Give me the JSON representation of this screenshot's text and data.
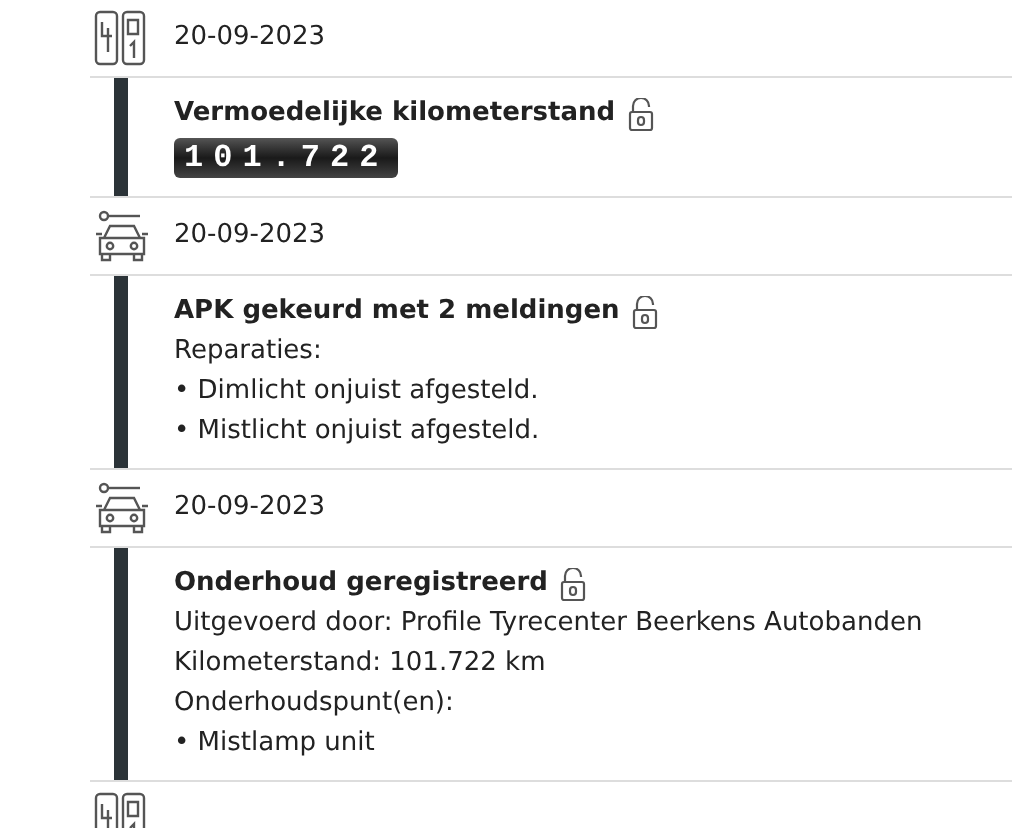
{
  "events": [
    {
      "kind": "odometer",
      "date": "20-09-2023",
      "title": "Vermoedelijke kilometerstand",
      "reading": "101.722"
    },
    {
      "kind": "service",
      "date": "20-09-2023",
      "title": "APK gekeurd met 2 meldingen",
      "lines": [
        "Reparaties:",
        "• Dimlicht onjuist afgesteld.",
        "• Mistlicht onjuist afgesteld."
      ]
    },
    {
      "kind": "service",
      "date": "20-09-2023",
      "title": "Onderhoud geregistreerd",
      "lines": [
        "Uitgevoerd door: Profile Tyrecenter Beerkens Autobanden",
        "Kilometerstand: 101.722 km",
        "Onderhoudspunt(en):",
        "• Mistlamp unit"
      ]
    },
    {
      "kind": "odometer"
    }
  ]
}
